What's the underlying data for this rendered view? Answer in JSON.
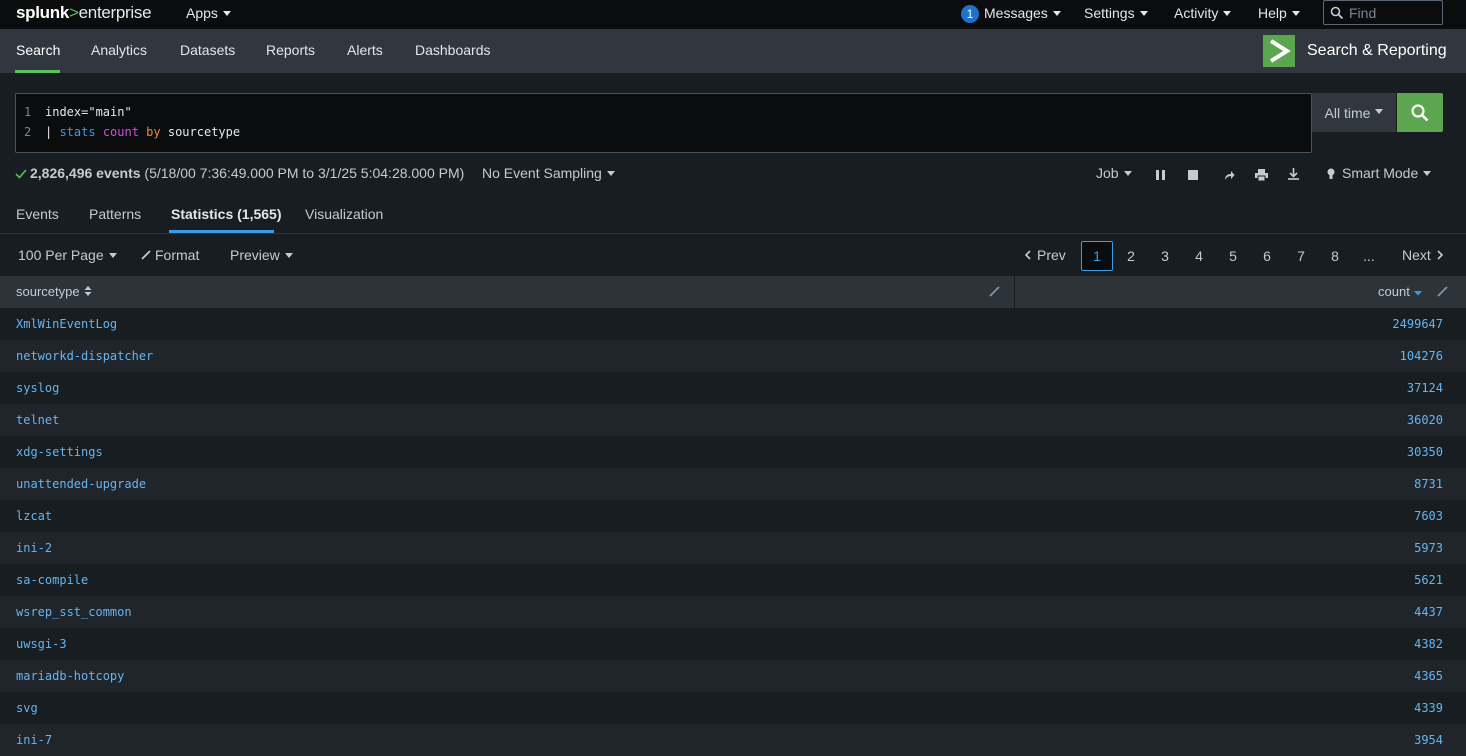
{
  "topbar": {
    "logo_main": "splunk",
    "logo_sep": ">",
    "logo_sub": "enterprise",
    "apps_label": "Apps",
    "messages_count": "1",
    "messages_label": "Messages",
    "settings_label": "Settings",
    "activity_label": "Activity",
    "help_label": "Help",
    "find_placeholder": "Find"
  },
  "nav": {
    "tabs": [
      {
        "label": "Search"
      },
      {
        "label": "Analytics"
      },
      {
        "label": "Datasets"
      },
      {
        "label": "Reports"
      },
      {
        "label": "Alerts"
      },
      {
        "label": "Dashboards"
      }
    ],
    "active_tab": "Search",
    "app_title": "Search & Reporting",
    "app_icon": "chevron-right-icon"
  },
  "search": {
    "lines": [
      {
        "num": "1",
        "text": "index=\"main\""
      },
      {
        "num": "2",
        "pipe": "| ",
        "cmd": "stats",
        "fn": "count",
        "by": "by",
        "field": "sourcetype"
      }
    ],
    "time_range": "All time",
    "search_icon": "magnifier-icon"
  },
  "status": {
    "events_count": "2,826,496 events",
    "range": "(5/18/00 7:36:49.000 PM to 3/1/25 5:04:28.000 PM)",
    "sampling": "No Event Sampling",
    "job_label": "Job",
    "mode_label": "Smart Mode"
  },
  "result_tabs": [
    {
      "label": "Events"
    },
    {
      "label": "Patterns"
    },
    {
      "label": "Statistics (1,565)"
    },
    {
      "label": "Visualization"
    }
  ],
  "toolbar": {
    "per_page": "100 Per Page",
    "format": "Format",
    "preview": "Preview",
    "prev": "Prev",
    "next": "Next",
    "pages": [
      "1",
      "2",
      "3",
      "4",
      "5",
      "6",
      "7",
      "8",
      "..."
    ],
    "current_page": "1"
  },
  "table": {
    "columns": [
      "sourcetype",
      "count"
    ],
    "rows": [
      {
        "sourcetype": "XmlWinEventLog",
        "count": "2499647"
      },
      {
        "sourcetype": "networkd-dispatcher",
        "count": "104276"
      },
      {
        "sourcetype": "syslog",
        "count": "37124"
      },
      {
        "sourcetype": "telnet",
        "count": "36020"
      },
      {
        "sourcetype": "xdg-settings",
        "count": "30350"
      },
      {
        "sourcetype": "unattended-upgrade",
        "count": "8731"
      },
      {
        "sourcetype": "lzcat",
        "count": "7603"
      },
      {
        "sourcetype": "ini-2",
        "count": "5973"
      },
      {
        "sourcetype": "sa-compile",
        "count": "5621"
      },
      {
        "sourcetype": "wsrep_sst_common",
        "count": "4437"
      },
      {
        "sourcetype": "uwsgi-3",
        "count": "4382"
      },
      {
        "sourcetype": "mariadb-hotcopy",
        "count": "4365"
      },
      {
        "sourcetype": "svg",
        "count": "4339"
      },
      {
        "sourcetype": "ini-7",
        "count": "3954"
      }
    ]
  },
  "colors": {
    "accent_green": "#5ba64f",
    "link_blue": "#65b5f0",
    "tab_blue": "#3c9be6"
  }
}
